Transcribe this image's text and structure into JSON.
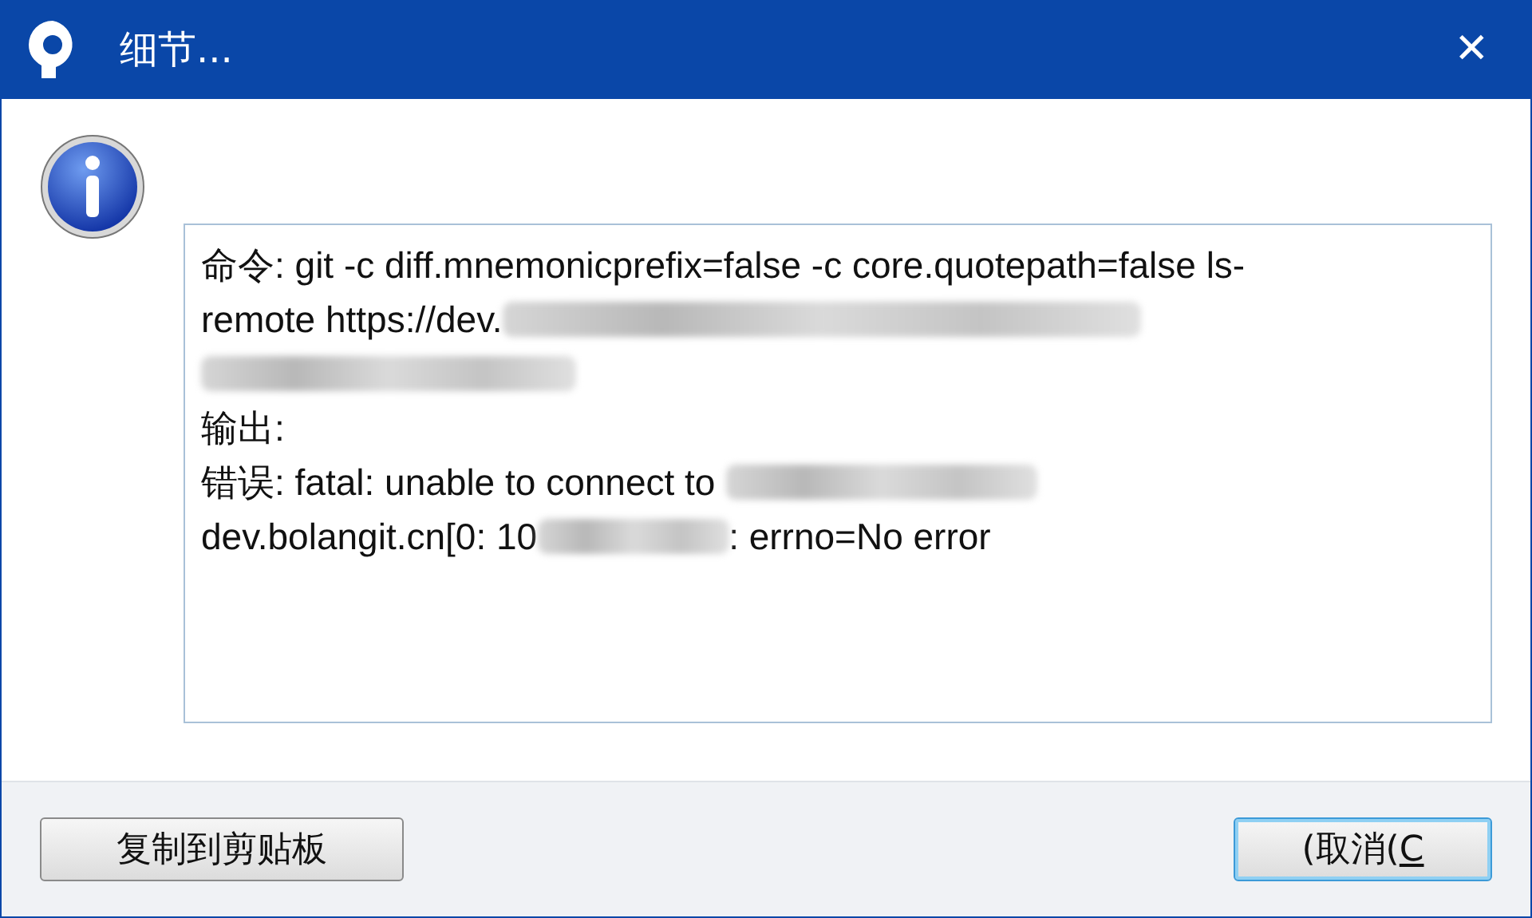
{
  "window": {
    "title": "细节...",
    "close": "✕"
  },
  "details": {
    "lines": [
      [
        {
          "kind": "text",
          "text": "命令: git -c diff.mnemonicprefix=false -c core.quotepath=false ls-"
        }
      ],
      [
        {
          "kind": "text",
          "text": "remote https://dev."
        },
        {
          "kind": "redacted"
        }
      ],
      [
        {
          "kind": "redacted"
        }
      ],
      [
        {
          "kind": "text",
          "text": "输出:"
        }
      ],
      [
        {
          "kind": "text",
          "text": "错误: fatal: unable to connect to "
        },
        {
          "kind": "redacted"
        }
      ],
      [
        {
          "kind": "text",
          "text": "dev.bolangit.cn[0: 10"
        },
        {
          "kind": "redacted"
        },
        {
          "kind": "text",
          "text": ": errno=No error"
        }
      ]
    ]
  },
  "buttons": [
    {
      "kind": "plain",
      "label": "复制到剪贴板"
    },
    {
      "kind": "default",
      "label": "(取消(",
      "accelerator": "C"
    }
  ]
}
